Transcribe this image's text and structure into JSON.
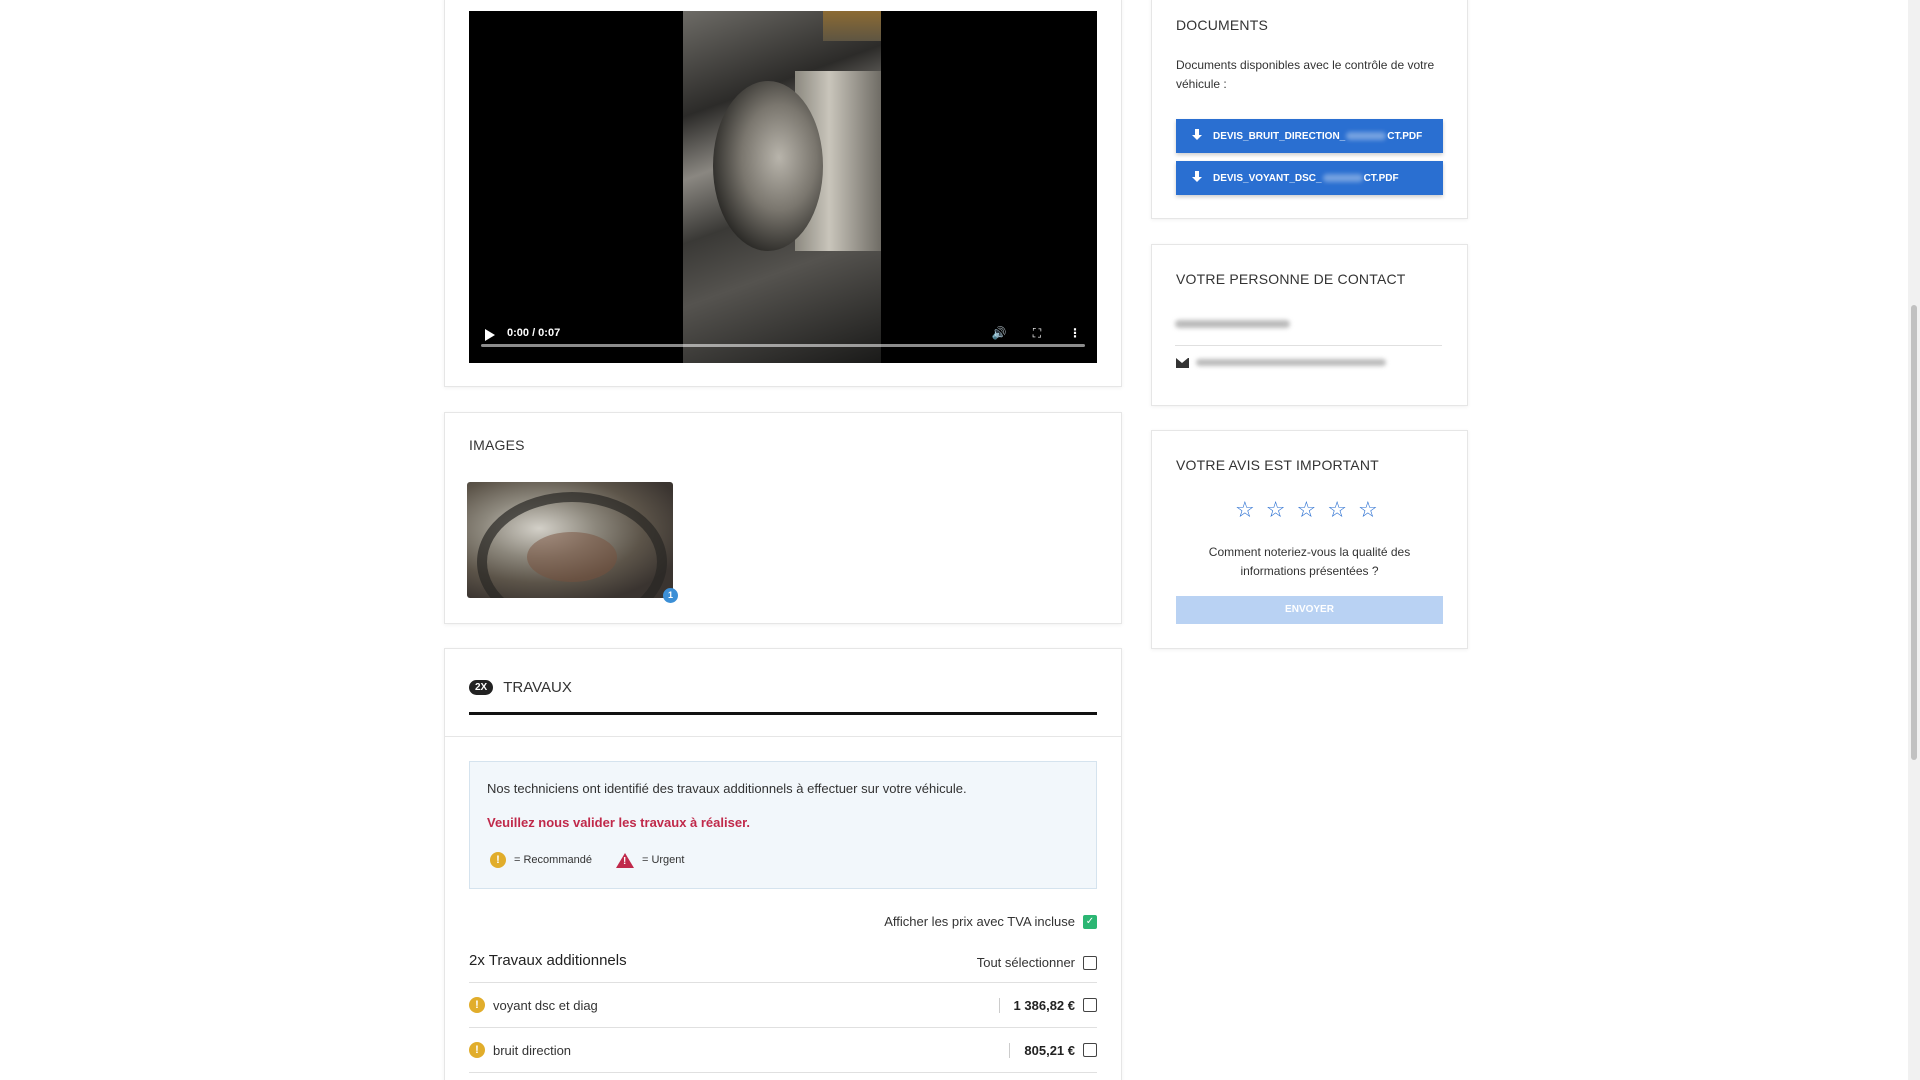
{
  "video": {
    "time": "0:00 / 0:07",
    "icons": {
      "play": "play-icon",
      "volume": "volume-icon",
      "fullscreen": "fullscreen-icon",
      "more": "more-vertical-icon"
    }
  },
  "images": {
    "title": "IMAGES",
    "thumbnail_badge": "1"
  },
  "travaux": {
    "tab_count": "2X",
    "tab_title": "TRAVAUX",
    "info_text": "Nos techniciens ont identifié des travaux additionnels à effectuer sur votre véhicule.",
    "warning_text": "Veuillez nous valider les travaux à réaliser.",
    "legend_recommended": "= Recommandé",
    "legend_urgent": "= Urgent",
    "tva_label": "Afficher les prix avec TVA incluse",
    "tva_checked": true,
    "group_title": "2x Travaux additionnels",
    "select_all_label": "Tout sélectionner",
    "items": [
      {
        "label": "voyant dsc et diag",
        "price": "1 386,82 €",
        "level": "recommended"
      },
      {
        "label": "bruit direction",
        "price": "805,21 €",
        "level": "recommended"
      }
    ]
  },
  "documents": {
    "title": "DOCUMENTS",
    "description": "Documents disponibles avec le contrôle de votre véhicule :",
    "files": [
      {
        "prefix": "DEVIS_BRUIT_DIRECTION_",
        "suffix": "CT.PDF"
      },
      {
        "prefix": "DEVIS_VOYANT_DSC_",
        "suffix": "CT.PDF"
      }
    ]
  },
  "contact": {
    "title": "VOTRE PERSONNE DE CONTACT"
  },
  "avis": {
    "title": "VOTRE AVIS EST IMPORTANT",
    "stars": [
      "☆",
      "☆",
      "☆",
      "☆",
      "☆"
    ],
    "question": "Comment noteriez-vous la qualité des informations présentées ?",
    "send_label": "ENVOYER"
  },
  "colors": {
    "accent_blue": "#2a6fd1",
    "urgent_red": "#c0294a",
    "recommended_yellow": "#e1ad2b",
    "check_green": "#2bb673"
  }
}
